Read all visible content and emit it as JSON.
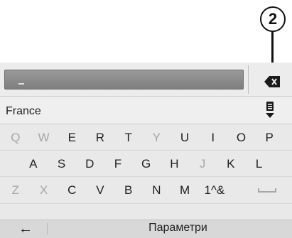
{
  "callout": {
    "number": "2"
  },
  "input": {
    "value": "_"
  },
  "country": {
    "value": "France"
  },
  "keyboard": {
    "rows": [
      [
        {
          "label": "Q",
          "active": false
        },
        {
          "label": "W",
          "active": false
        },
        {
          "label": "E",
          "active": true
        },
        {
          "label": "R",
          "active": true
        },
        {
          "label": "T",
          "active": true
        },
        {
          "label": "Y",
          "active": false
        },
        {
          "label": "U",
          "active": true
        },
        {
          "label": "I",
          "active": true
        },
        {
          "label": "O",
          "active": true
        },
        {
          "label": "P",
          "active": true
        }
      ],
      [
        {
          "label": "A",
          "active": true
        },
        {
          "label": "S",
          "active": true
        },
        {
          "label": "D",
          "active": true
        },
        {
          "label": "F",
          "active": true
        },
        {
          "label": "G",
          "active": true
        },
        {
          "label": "H",
          "active": true
        },
        {
          "label": "J",
          "active": false
        },
        {
          "label": "K",
          "active": true
        },
        {
          "label": "L",
          "active": true
        }
      ],
      [
        {
          "label": "Z",
          "active": false
        },
        {
          "label": "X",
          "active": false
        },
        {
          "label": "C",
          "active": true
        },
        {
          "label": "V",
          "active": true
        },
        {
          "label": "B",
          "active": true
        },
        {
          "label": "N",
          "active": true
        },
        {
          "label": "M",
          "active": true
        },
        {
          "label": "1^&",
          "active": true
        },
        {
          "label": "␣",
          "active": false
        }
      ]
    ]
  },
  "bottom_bar": {
    "back_icon": "←",
    "parameters_label": "Параметри"
  },
  "icons": {
    "backspace": "backspace-icon",
    "list": "list-dropdown-icon",
    "back": "back-arrow-icon"
  },
  "colors": {
    "screen_bg": "#e9e9e9",
    "input_bg": "#8a8a8a",
    "text": "#222222",
    "dim_text": "#a7a7a7"
  }
}
